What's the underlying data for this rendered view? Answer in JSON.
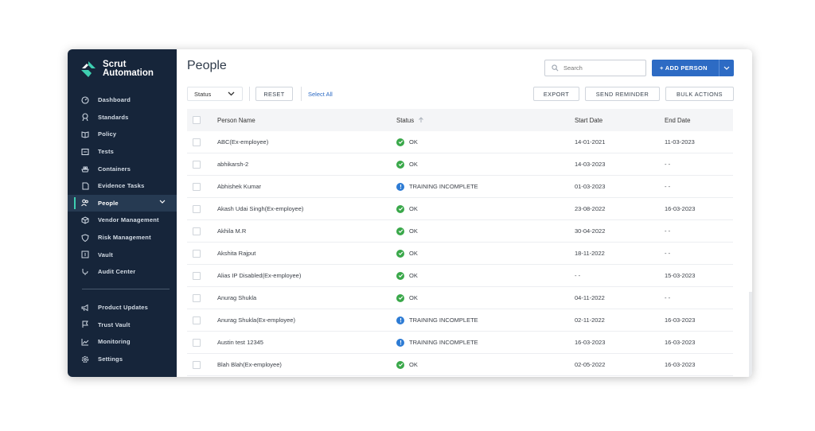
{
  "brand": {
    "line1": "Scrut",
    "line2": "Automation",
    "accent": "#3ecfb1"
  },
  "page": {
    "title": "People"
  },
  "sidebar": {
    "items": [
      {
        "label": "Dashboard",
        "icon": "dashboard-icon"
      },
      {
        "label": "Standards",
        "icon": "standards-icon"
      },
      {
        "label": "Policy",
        "icon": "policy-icon"
      },
      {
        "label": "Tests",
        "icon": "tests-icon"
      },
      {
        "label": "Containers",
        "icon": "containers-icon"
      },
      {
        "label": "Evidence Tasks",
        "icon": "evidence-icon"
      },
      {
        "label": "People",
        "icon": "people-icon",
        "active": true
      },
      {
        "label": "Vendor Management",
        "icon": "vendor-icon"
      },
      {
        "label": "Risk Management",
        "icon": "shield-icon"
      },
      {
        "label": "Vault",
        "icon": "vault-icon"
      },
      {
        "label": "Audit Center",
        "icon": "stethoscope-icon"
      }
    ],
    "bottom_items": [
      {
        "label": "Product Updates",
        "icon": "megaphone-icon"
      },
      {
        "label": "Trust Vault",
        "icon": "flag-icon"
      },
      {
        "label": "Monitoring",
        "icon": "chart-icon"
      },
      {
        "label": "Settings",
        "icon": "gear-icon"
      }
    ]
  },
  "header": {
    "search_placeholder": "Search",
    "add_person_label": "+ ADD PERSON"
  },
  "toolbar": {
    "status_filter": "Status",
    "reset_label": "RESET",
    "select_all_label": "Select All",
    "export_label": "EXPORT",
    "send_reminder_label": "SEND REMINDER",
    "bulk_actions_label": "BULK ACTIONS"
  },
  "table": {
    "columns": {
      "name": "Person Name",
      "status": "Status",
      "start": "Start Date",
      "end": "End Date"
    },
    "rows": [
      {
        "name": "ABC(Ex-employee)",
        "status": "OK",
        "kind": "ok",
        "start": "14-01-2021",
        "end": "11-03-2023"
      },
      {
        "name": "abhikarsh-2",
        "status": "OK",
        "kind": "ok",
        "start": "14-03-2023",
        "end": "- -"
      },
      {
        "name": "Abhishek Kumar",
        "status": "TRAINING INCOMPLETE",
        "kind": "warn",
        "start": "01-03-2023",
        "end": "- -"
      },
      {
        "name": "Akash Udai Singh(Ex-employee)",
        "status": "OK",
        "kind": "ok",
        "start": "23-08-2022",
        "end": "16-03-2023"
      },
      {
        "name": "Akhila M.R",
        "status": "OK",
        "kind": "ok",
        "start": "30-04-2022",
        "end": "- -"
      },
      {
        "name": "Akshita Rajput",
        "status": "OK",
        "kind": "ok",
        "start": "18-11-2022",
        "end": "- -"
      },
      {
        "name": "Alias IP Disabled(Ex-employee)",
        "status": "OK",
        "kind": "ok",
        "start": "- -",
        "end": "15-03-2023"
      },
      {
        "name": "Anurag Shukla",
        "status": "OK",
        "kind": "ok",
        "start": "04-11-2022",
        "end": "- -"
      },
      {
        "name": "Anurag Shukla(Ex-employee)",
        "status": "TRAINING INCOMPLETE",
        "kind": "warn",
        "start": "02-11-2022",
        "end": "16-03-2023"
      },
      {
        "name": "Austin test 12345",
        "status": "TRAINING INCOMPLETE",
        "kind": "warn",
        "start": "16-03-2023",
        "end": "16-03-2023"
      },
      {
        "name": "Blah Blah(Ex-employee)",
        "status": "OK",
        "kind": "ok",
        "start": "02-05-2022",
        "end": "16-03-2023"
      }
    ]
  },
  "colors": {
    "sidebar_bg": "#16253a",
    "primary": "#2d6bc4",
    "ok": "#3aa84a",
    "warn": "#2d7bd4"
  }
}
